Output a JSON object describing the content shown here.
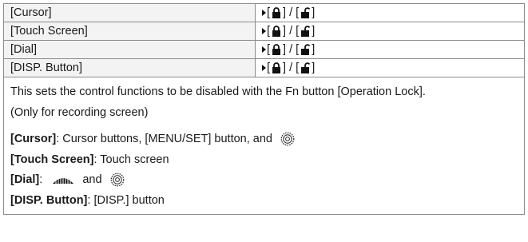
{
  "rows": [
    {
      "label": "[Cursor]"
    },
    {
      "label": "[Touch Screen]"
    },
    {
      "label": "[Dial]"
    },
    {
      "label": "[DISP. Button]"
    }
  ],
  "value_parts": {
    "open_bracket": "[",
    "close_bracket": "]",
    "separator": " / "
  },
  "description": {
    "line1": "This sets the control functions to be disabled with the Fn button [Operation Lock].",
    "line2": "(Only for recording screen)",
    "items": [
      {
        "term": "[Cursor]",
        "text": ": Cursor buttons, [MENU/SET] button, and",
        "trailing_icon": "control-dial-icon"
      },
      {
        "term": "[Touch Screen]",
        "text": ": Touch screen"
      },
      {
        "term": "[Dial]",
        "text": ":",
        "mid_icon": "front-dial-icon",
        "mid_text": "and",
        "trailing_icon": "control-dial-icon"
      },
      {
        "term": "[DISP. Button]",
        "text": ": [DISP.] button"
      }
    ]
  },
  "icons": [
    "play-triangle-icon",
    "lock-closed-icon",
    "lock-open-icon",
    "front-dial-icon",
    "control-dial-icon"
  ]
}
